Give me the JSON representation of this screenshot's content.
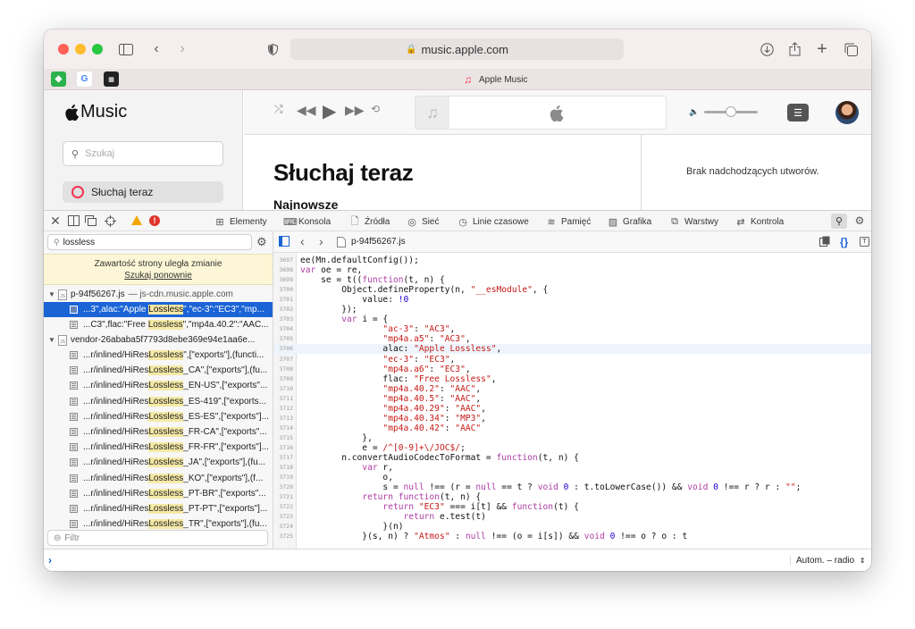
{
  "browser": {
    "url": "music.apple.com",
    "tab_title": "Apple Music",
    "favicons": [
      "feedly",
      "G",
      "app"
    ]
  },
  "apple_music": {
    "logo_text": "Music",
    "search_placeholder": "Szukaj",
    "nav_item": "Słuchaj teraz",
    "page_title": "Słuchaj teraz",
    "subheading": "Najnowsze dodatki",
    "up_next_empty": "Brak nadchodzących utworów."
  },
  "devtools": {
    "tabs": [
      "Elementy",
      "Konsola",
      "Źródła",
      "Sieć",
      "Linie czasowe",
      "Pamięć",
      "Grafika",
      "Warstwy",
      "Kontrola"
    ],
    "search": {
      "query": "lossless",
      "notice_line1": "Zawartość strony uległa zmianie",
      "notice_link": "Szukaj ponownie",
      "filter_placeholder": "Filtr",
      "files": [
        {
          "name": "p-94f56267.js",
          "host": "— js-cdn.music.apple.com"
        },
        {
          "name": "vendor-26ababa5f7793d8ebe369e94e1aa6e...",
          "host": ""
        }
      ],
      "results": [
        {
          "pre": "...3\",alac:\"Apple ",
          "match": "Lossless",
          "post": "\",\"ec-3\":\"EC3\",\"mp...",
          "selected": true
        },
        {
          "pre": "...C3\",flac:\"Free ",
          "match": "Lossless",
          "post": "\",\"mp4a.40.2\":\"AAC...",
          "selected": false
        },
        {
          "pre": "...r/inlined/HiRes",
          "match": "Lossless",
          "post": "\",[\"exports\"],(functi...",
          "selected": false
        },
        {
          "pre": "...r/inlined/HiRes",
          "match": "Lossless",
          "post": "_CA\",[\"exports\"],(fu...",
          "selected": false
        },
        {
          "pre": "...r/inlined/HiRes",
          "match": "Lossless",
          "post": "_EN-US\",[\"exports\"...",
          "selected": false
        },
        {
          "pre": "...r/inlined/HiRes",
          "match": "Lossless",
          "post": "_ES-419\",[\"exports...",
          "selected": false
        },
        {
          "pre": "...r/inlined/HiRes",
          "match": "Lossless",
          "post": "_ES-ES\",[\"exports\"]...",
          "selected": false
        },
        {
          "pre": "...r/inlined/HiRes",
          "match": "Lossless",
          "post": "_FR-CA\",[\"exports\"...",
          "selected": false
        },
        {
          "pre": "...r/inlined/HiRes",
          "match": "Lossless",
          "post": "_FR-FR\",[\"exports\"]...",
          "selected": false
        },
        {
          "pre": "...r/inlined/HiRes",
          "match": "Lossless",
          "post": "_JA\",[\"exports\"],(fu...",
          "selected": false
        },
        {
          "pre": "...r/inlined/HiRes",
          "match": "Lossless",
          "post": "_KO\",[\"exports\"],(f...",
          "selected": false
        },
        {
          "pre": "...r/inlined/HiRes",
          "match": "Lossless",
          "post": "_PT-BR\",[\"exports\"...",
          "selected": false
        },
        {
          "pre": "...r/inlined/HiRes",
          "match": "Lossless",
          "post": "_PT-PT\",[\"exports\"]...",
          "selected": false
        },
        {
          "pre": "...r/inlined/HiRes",
          "match": "Lossless",
          "post": "_TR\",[\"exports\"],(fu...",
          "selected": false
        }
      ]
    },
    "source": {
      "filename": "p-94f56267.js",
      "lines": [
        {
          "n": "3697",
          "html": "ee(Mn.defaultConfig());"
        },
        {
          "n": "3698",
          "html": "<span class=\"kw\">var</span> oe = re,"
        },
        {
          "n": "3699",
          "html": "    se = t((<span class=\"kw\">function</span>(t, n) {"
        },
        {
          "n": "3700",
          "html": "        Object.defineProperty(n, <span class=\"st\">\"__esModule\"</span>, {"
        },
        {
          "n": "3701",
          "html": "            value: <span class=\"nm\">!0</span>"
        },
        {
          "n": "3702",
          "html": "        });"
        },
        {
          "n": "3703",
          "html": "        <span class=\"kw\">var</span> i = {"
        },
        {
          "n": "3704",
          "html": "                <span class=\"st\">\"ac-3\"</span>: <span class=\"st\">\"AC3\"</span>,"
        },
        {
          "n": "3705",
          "html": "                <span class=\"st\">\"mp4a.a5\"</span>: <span class=\"st\">\"AC3\"</span>,"
        },
        {
          "n": "3706",
          "html": "                alac: <span class=\"st\">\"Apple Lossless\"</span>,"
        },
        {
          "n": "3707",
          "html": "                <span class=\"st\">\"ec-3\"</span>: <span class=\"st\">\"EC3\"</span>,"
        },
        {
          "n": "3708",
          "html": "                <span class=\"st\">\"mp4a.a6\"</span>: <span class=\"st\">\"EC3\"</span>,"
        },
        {
          "n": "3709",
          "html": "                flac: <span class=\"st\">\"Free Lossless\"</span>,"
        },
        {
          "n": "3710",
          "html": "                <span class=\"st\">\"mp4a.40.2\"</span>: <span class=\"st\">\"AAC\"</span>,"
        },
        {
          "n": "3711",
          "html": "                <span class=\"st\">\"mp4a.40.5\"</span>: <span class=\"st\">\"AAC\"</span>,"
        },
        {
          "n": "3712",
          "html": "                <span class=\"st\">\"mp4a.40.29\"</span>: <span class=\"st\">\"AAC\"</span>,"
        },
        {
          "n": "3713",
          "html": "                <span class=\"st\">\"mp4a.40.34\"</span>: <span class=\"st\">\"MP3\"</span>,"
        },
        {
          "n": "3714",
          "html": "                <span class=\"st\">\"mp4a.40.42\"</span>: <span class=\"st\">\"AAC\"</span>"
        },
        {
          "n": "3715",
          "html": "            },"
        },
        {
          "n": "3716",
          "html": "            e = <span class=\"rx\">/^[0-9]+\\/JOC$/</span>;"
        },
        {
          "n": "3717",
          "html": "        n.convertAudioCodecToFormat = <span class=\"kw\">function</span>(t, n) {"
        },
        {
          "n": "3718",
          "html": "            <span class=\"kw\">var</span> r,"
        },
        {
          "n": "3719",
          "html": "                o,"
        },
        {
          "n": "3720",
          "html": "                s = <span class=\"kw\">null</span> !== (r = <span class=\"kw\">null</span> == t ? <span class=\"kw\">void</span> <span class=\"nm\">0</span> : t.toLowerCase()) &amp;&amp; <span class=\"kw\">void</span> <span class=\"nm\">0</span> !== r ? r : <span class=\"st\">\"\"</span>;"
        },
        {
          "n": "3721",
          "html": "            <span class=\"kw\">return</span> <span class=\"kw\">function</span>(t, n) {"
        },
        {
          "n": "3722",
          "html": "                <span class=\"kw\">return</span> <span class=\"st\">\"EC3\"</span> === i[t] &amp;&amp; <span class=\"kw\">function</span>(t) {"
        },
        {
          "n": "3723",
          "html": "                    <span class=\"kw\">return</span> e.test(t)"
        },
        {
          "n": "3724",
          "html": "                }(n)"
        },
        {
          "n": "3725",
          "html": "            }(s, n) ? <span class=\"st\">\"Atmos\"</span> : <span class=\"kw\">null</span> !== (o = i[s]) &amp;&amp; <span class=\"kw\">void</span> <span class=\"nm\">0</span> !== o ? o : t"
        }
      ]
    },
    "console_context": "Autom. – radio"
  }
}
